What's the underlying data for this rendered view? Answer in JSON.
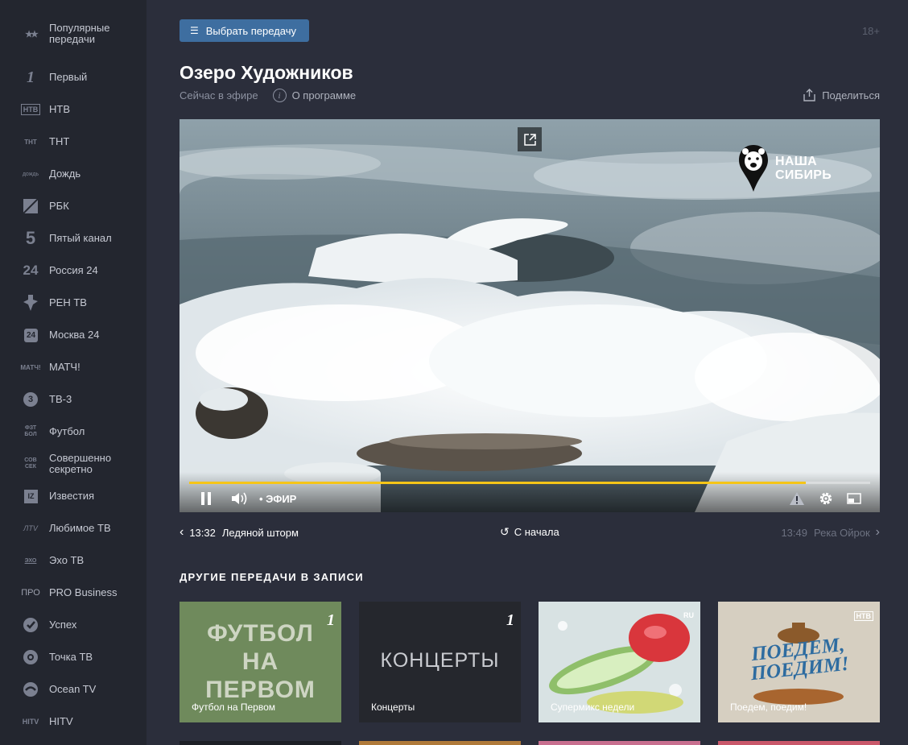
{
  "sidebar": {
    "items": [
      {
        "label": "Популярные передачи",
        "icon": "stars-icon"
      },
      {
        "label": "Первый",
        "icon": "channel-1-icon"
      },
      {
        "label": "НТВ",
        "icon": "ntv-icon"
      },
      {
        "label": "ТНТ",
        "icon": "tnt-icon"
      },
      {
        "label": "Дождь",
        "icon": "dozhd-icon"
      },
      {
        "label": "РБК",
        "icon": "rbc-icon"
      },
      {
        "label": "Пятый канал",
        "icon": "channel-5-icon"
      },
      {
        "label": "Россия 24",
        "icon": "russia-24-icon"
      },
      {
        "label": "РЕН ТВ",
        "icon": "ren-tv-icon"
      },
      {
        "label": "Москва 24",
        "icon": "moscow-24-icon"
      },
      {
        "label": "МАТЧ!",
        "icon": "match-icon"
      },
      {
        "label": "ТВ-3",
        "icon": "tv3-icon"
      },
      {
        "label": "Футбол",
        "icon": "football-icon"
      },
      {
        "label": "Совершенно секретно",
        "icon": "top-secret-icon"
      },
      {
        "label": "Известия",
        "icon": "izvestia-icon"
      },
      {
        "label": "Любимое ТВ",
        "icon": "lyubimoe-tv-icon"
      },
      {
        "label": "Эхо ТВ",
        "icon": "echo-tv-icon"
      },
      {
        "label": "PRO Business",
        "icon": "pro-business-icon"
      },
      {
        "label": "Успех",
        "icon": "uspekh-icon"
      },
      {
        "label": "Точка ТВ",
        "icon": "tochka-tv-icon"
      },
      {
        "label": "Ocean TV",
        "icon": "ocean-tv-icon"
      },
      {
        "label": "HITV",
        "icon": "hitv-icon"
      }
    ],
    "icon_glyphs": [
      "★★",
      "1",
      "НТВ",
      "ТНТ",
      "дождь",
      "",
      "5",
      "24",
      "",
      "24",
      "МАТЧ!",
      "3",
      "ФЗТ БОЛ",
      "СОВ СЕК",
      "IZ",
      "ЛTV",
      "ЭХО",
      "ПРО",
      "",
      "",
      "",
      "HITV"
    ]
  },
  "header": {
    "select_label": "Выбрать передачу",
    "age_rating": "18+",
    "title": "Озеро Художников",
    "now_live": "Сейчас в эфире",
    "info_glyph": "i",
    "about_label": "О программе",
    "share_label": "Поделиться"
  },
  "player": {
    "channel_logo_line1": "НАША",
    "channel_logo_line2": "СИБИРЬ",
    "live_label": "• ЭФИР",
    "progress": 0.906,
    "accent_color": "#f5c518"
  },
  "program_nav": {
    "prev_time": "13:32",
    "prev_title": "Ледяной шторм",
    "restart_label": "С начала",
    "next_time": "13:49",
    "next_title": "Река Ойрок"
  },
  "section_title": "ДРУГИЕ ПЕРЕДАЧИ В ЗАПИСИ",
  "cards": [
    {
      "caption": "Футбол на Первом",
      "art_text": [
        "ФУТБОЛ",
        "НА",
        "ПЕРВОМ"
      ],
      "badge_icon": "channel-1-icon"
    },
    {
      "caption": "Концерты",
      "art_text": [
        "КОНЦЕРТЫ"
      ],
      "badge_icon": "channel-1-icon"
    },
    {
      "caption": "Супермикс недели",
      "art_text": [],
      "badge_icon": "ru-tv-icon",
      "badge_text": "RU"
    },
    {
      "caption": "Поедем, поедим!",
      "art_text": [
        "ПОЕДЕМ,",
        "ПОЕДИМ!"
      ],
      "badge_icon": "ntv-icon",
      "badge_text": "НТВ"
    }
  ]
}
